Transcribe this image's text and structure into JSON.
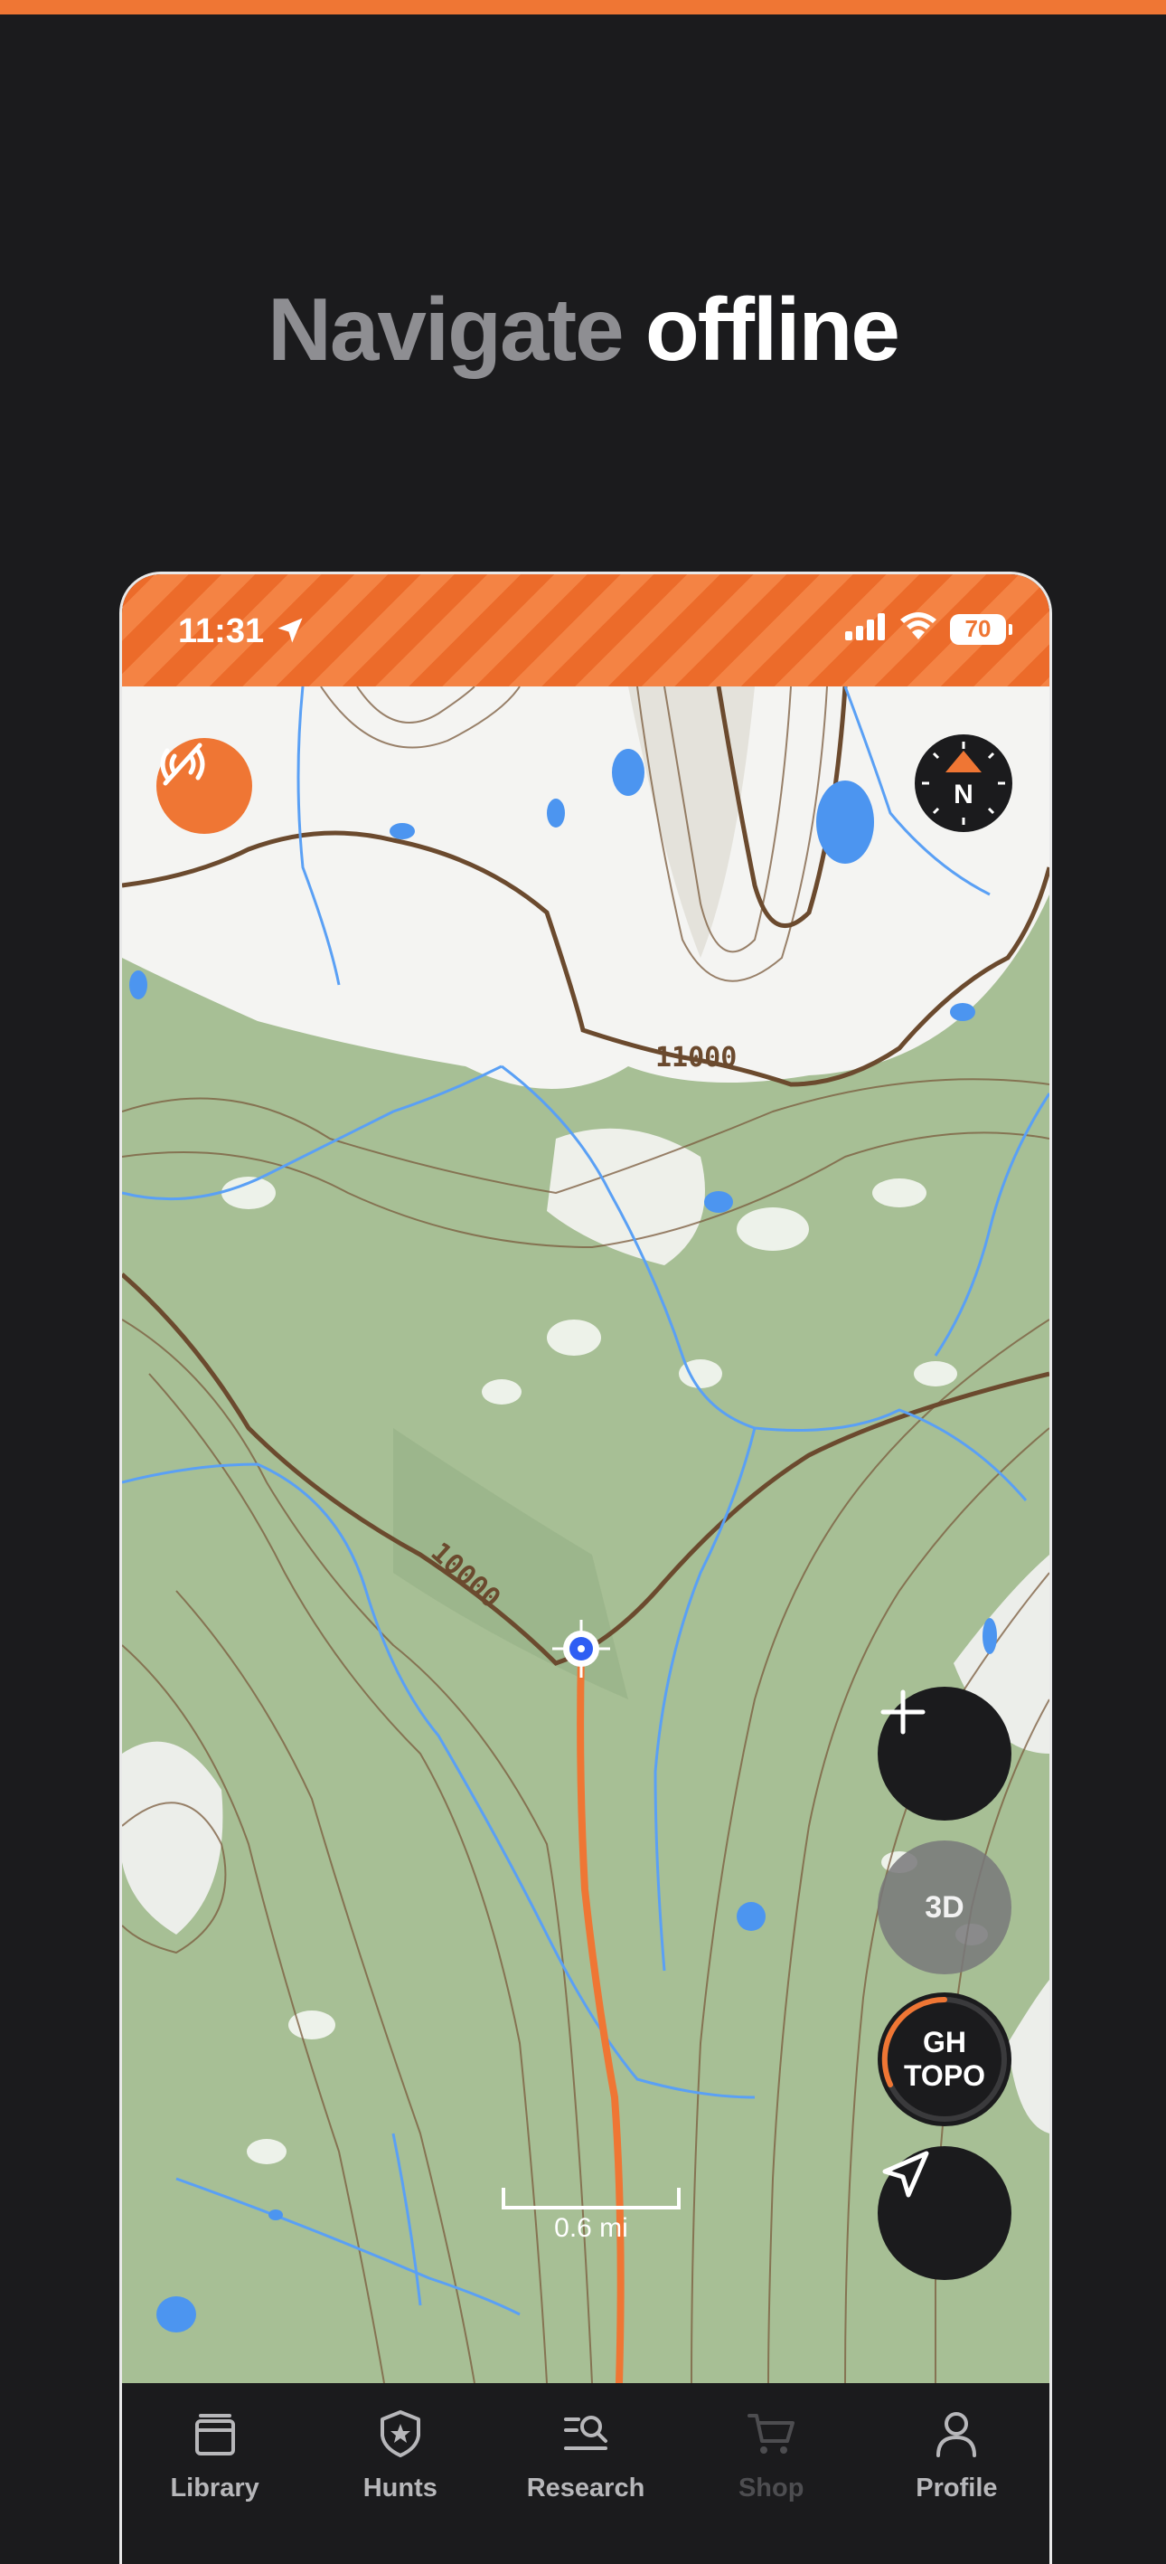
{
  "headline": {
    "part1": "Navigate",
    "part2": "offline"
  },
  "status_bar": {
    "time": "11:31",
    "battery": "70"
  },
  "map": {
    "contour_labels": [
      "11000",
      "10000"
    ],
    "scale_label": "0.6 mi",
    "compass_label": "N",
    "layer_button": {
      "line1": "GH",
      "line2": "TOPO"
    },
    "three_d_label": "3D",
    "zoom_in_symbol": "+"
  },
  "tabbar": {
    "items": [
      {
        "label": "Library",
        "icon": "library-icon",
        "enabled": true
      },
      {
        "label": "Hunts",
        "icon": "hunts-badge-icon",
        "enabled": true
      },
      {
        "label": "Research",
        "icon": "research-icon",
        "enabled": true
      },
      {
        "label": "Shop",
        "icon": "cart-icon",
        "enabled": false
      },
      {
        "label": "Profile",
        "icon": "profile-icon",
        "enabled": true
      }
    ]
  },
  "colors": {
    "accent": "#ef7634",
    "background": "#1b1b1d",
    "map_vegetation": "#a7bf95",
    "water": "#4c95f0",
    "contour": "#7a5a3c",
    "track": "#ef7634"
  }
}
